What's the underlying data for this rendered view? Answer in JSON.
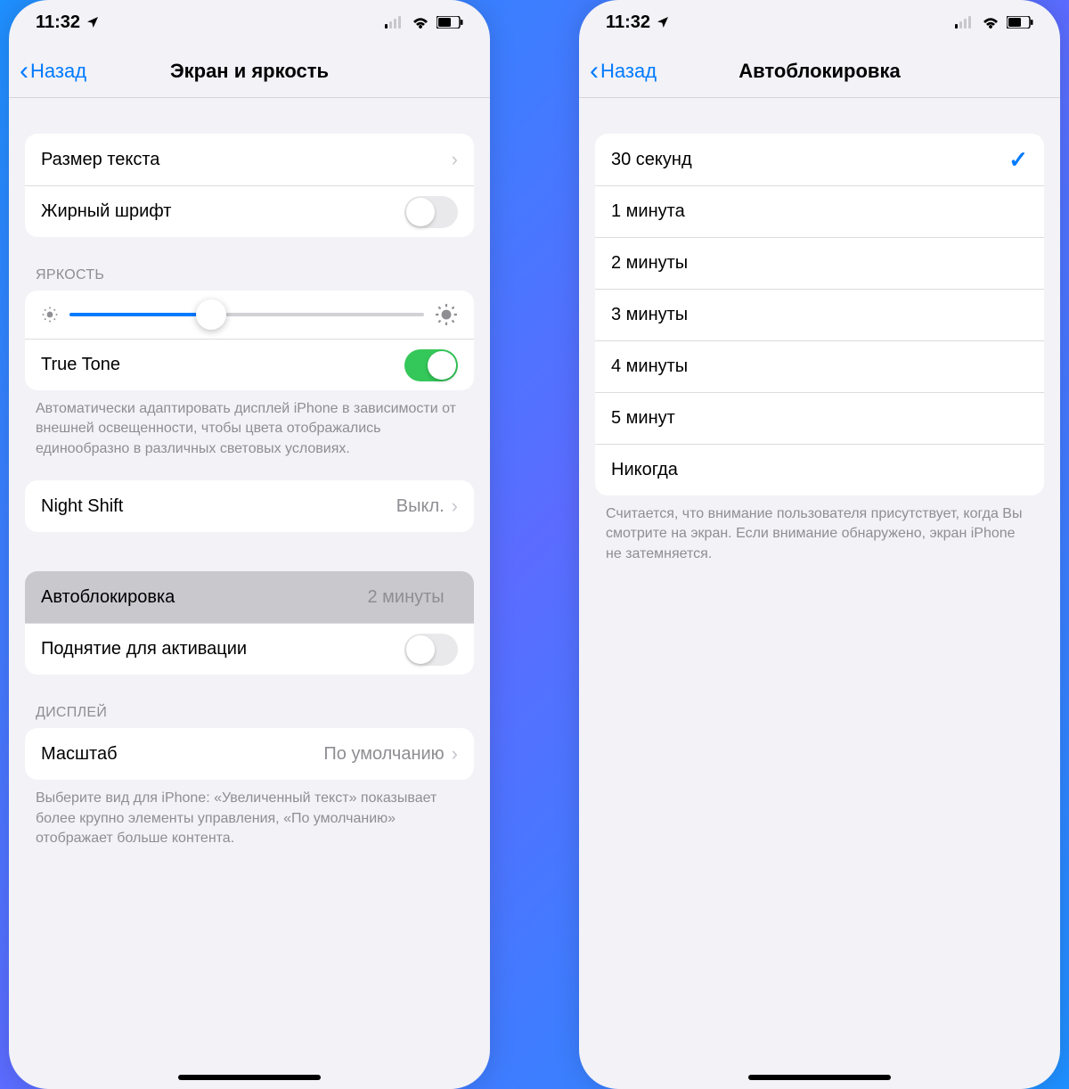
{
  "status": {
    "time": "11:32",
    "location_icon": "location-arrow",
    "cell_icon": "cellular-dual",
    "wifi_icon": "wifi",
    "battery_icon": "battery-half"
  },
  "screen1": {
    "back_label": "Назад",
    "title": "Экран и яркость",
    "text_size_label": "Размер текста",
    "bold_text_label": "Жирный шрифт",
    "bold_text_on": false,
    "brightness_header": "ЯРКОСТЬ",
    "brightness_pct": 40,
    "true_tone_label": "True Tone",
    "true_tone_on": true,
    "true_tone_footer": "Автоматически адаптировать дисплей iPhone в зависимости от внешней освещенности, чтобы цвета отображались единообразно в различных световых условиях.",
    "night_shift_label": "Night Shift",
    "night_shift_value": "Выкл.",
    "autolock_label": "Автоблокировка",
    "autolock_value": "2 минуты",
    "raise_to_wake_label": "Поднятие для активации",
    "raise_to_wake_on": false,
    "display_header": "ДИСПЛЕЙ",
    "zoom_label": "Масштаб",
    "zoom_value": "По умолчанию",
    "zoom_footer": "Выберите вид для iPhone: «Увеличенный текст» показывает более крупно элементы управления, «По умолчанию» отображает больше контента."
  },
  "screen2": {
    "back_label": "Назад",
    "title": "Автоблокировка",
    "options": [
      {
        "label": "30 секунд",
        "selected": true
      },
      {
        "label": "1 минута",
        "selected": false
      },
      {
        "label": "2 минуты",
        "selected": false
      },
      {
        "label": "3 минуты",
        "selected": false
      },
      {
        "label": "4 минуты",
        "selected": false
      },
      {
        "label": "5 минут",
        "selected": false
      },
      {
        "label": "Никогда",
        "selected": false
      }
    ],
    "footer": "Считается, что внимание пользователя присутствует, когда Вы смотрите на экран. Если внимание обнаружено, экран iPhone не затемняется."
  }
}
